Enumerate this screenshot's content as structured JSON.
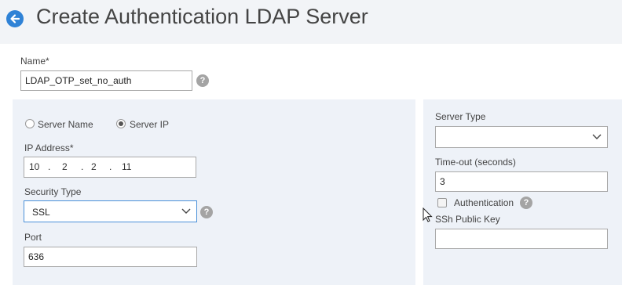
{
  "header": {
    "title": "Create Authentication LDAP Server"
  },
  "form": {
    "name": {
      "label": "Name*",
      "value": "LDAP_OTP_set_no_auth"
    },
    "server_mode": {
      "option_name": "Server Name",
      "option_ip": "Server IP",
      "selected": "Server IP"
    },
    "ip_address": {
      "label": "IP Address*",
      "octets": [
        "10",
        "2",
        "2",
        "11"
      ],
      "separator": "."
    },
    "security_type": {
      "label": "Security Type",
      "value": "SSL"
    },
    "port": {
      "label": "Port",
      "value": "636"
    },
    "server_type": {
      "label": "Server Type",
      "value": ""
    },
    "timeout": {
      "label": "Time-out (seconds)",
      "value": "3"
    },
    "authentication": {
      "label": "Authentication",
      "checked": false
    },
    "ssh_public_key": {
      "label": "SSh Public Key",
      "value": ""
    }
  },
  "icons": {
    "help": "?"
  },
  "colors": {
    "accent": "#2f82d6",
    "panel_bg": "#eef2f8",
    "help_icon": "#a4a4a4"
  }
}
